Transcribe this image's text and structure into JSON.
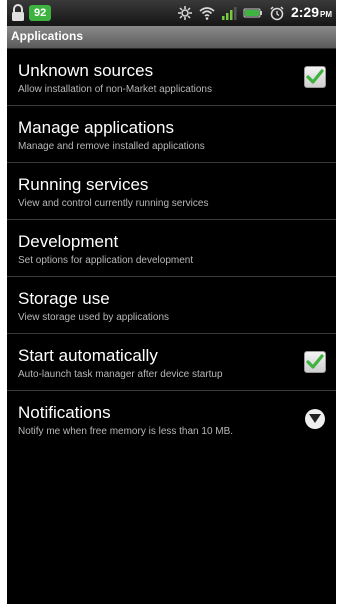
{
  "status_bar": {
    "battery_level": "92",
    "time": "2:29",
    "ampm": "PM",
    "icons": [
      "lock-icon",
      "bluetooth-icon",
      "wifi-icon",
      "signal-icon",
      "battery-icon",
      "alarm-icon"
    ]
  },
  "header": {
    "title": "Applications"
  },
  "items": [
    {
      "title": "Unknown sources",
      "summary": "Allow installation of non-Market applications",
      "control": "checkbox",
      "checked": true
    },
    {
      "title": "Manage applications",
      "summary": "Manage and remove installed applications"
    },
    {
      "title": "Running services",
      "summary": "View and control currently running services"
    },
    {
      "title": "Development",
      "summary": "Set options for application development"
    },
    {
      "title": "Storage use",
      "summary": "View storage used by applications"
    },
    {
      "title": "Start automatically",
      "summary": "Auto-launch task manager after device startup",
      "control": "checkbox",
      "checked": true
    },
    {
      "title": "Notifications",
      "summary": "Notify me when free memory is less than 10 MB.",
      "control": "dropdown"
    }
  ],
  "colors": {
    "background": "#000000",
    "check_green": "#3fb33f",
    "battery_badge": "#3fb33f"
  }
}
